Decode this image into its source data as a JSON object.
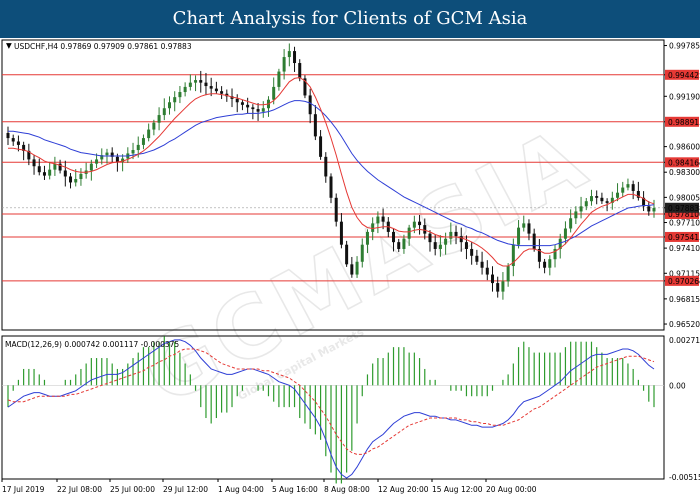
{
  "banner": {
    "title": "Chart Analysis for Clients of GCM Asia"
  },
  "chart_data": {
    "type": "candlestick",
    "price_panel": {
      "header": "USDCHF,H4  0.97869 0.97909 0.97861 0.97883",
      "y_ticks": [
        "0.99785",
        "0.99442",
        "0.99190",
        "0.98891",
        "0.98600",
        "0.98416",
        "0.98300",
        "0.98005",
        "0.97883",
        "0.97810",
        "0.97710",
        "0.97541",
        "0.97410",
        "0.97115",
        "0.97026",
        "0.96815",
        "0.96520"
      ],
      "ylim": [
        0.9645,
        0.9985
      ],
      "levels": [
        {
          "label": "0.99442",
          "value": 0.99442
        },
        {
          "label": "0.98891",
          "value": 0.98891
        },
        {
          "label": "0.98416",
          "value": 0.98416
        },
        {
          "label": "0.97810",
          "value": 0.9781
        },
        {
          "label": "0.97541",
          "value": 0.97541
        },
        {
          "label": "0.97026",
          "value": 0.97026
        }
      ],
      "current_price": {
        "label": "0.97883",
        "value": 0.97883
      },
      "series": [
        {
          "style": "red",
          "role": "fast moving average"
        },
        {
          "style": "blue",
          "role": "slow moving average"
        }
      ],
      "closes": [
        0.987,
        0.9866,
        0.9862,
        0.9855,
        0.9845,
        0.9837,
        0.983,
        0.9826,
        0.9833,
        0.984,
        0.9832,
        0.9825,
        0.9818,
        0.9822,
        0.9828,
        0.9832,
        0.984,
        0.9845,
        0.985,
        0.9853,
        0.9848,
        0.9842,
        0.9846,
        0.9852,
        0.9856,
        0.9862,
        0.987,
        0.988,
        0.9888,
        0.9897,
        0.9905,
        0.9912,
        0.9918,
        0.9924,
        0.993,
        0.9935,
        0.9938,
        0.9935,
        0.9931,
        0.9928,
        0.9925,
        0.9922,
        0.9919,
        0.9916,
        0.9912,
        0.9909,
        0.9906,
        0.9904,
        0.9901,
        0.9905,
        0.9915,
        0.993,
        0.9948,
        0.9965,
        0.9972,
        0.9958,
        0.994,
        0.992,
        0.9898,
        0.9872,
        0.9848,
        0.9825,
        0.98,
        0.9772,
        0.9745,
        0.9722,
        0.971,
        0.9725,
        0.9745,
        0.976,
        0.977,
        0.9778,
        0.9772,
        0.976,
        0.9748,
        0.974,
        0.9752,
        0.9765,
        0.9772,
        0.9768,
        0.9758,
        0.9748,
        0.974,
        0.9745,
        0.9752,
        0.976,
        0.9755,
        0.9748,
        0.974,
        0.9732,
        0.9725,
        0.9718,
        0.971,
        0.97,
        0.969,
        0.9702,
        0.972,
        0.9745,
        0.9765,
        0.977,
        0.9758,
        0.974,
        0.9725,
        0.9718,
        0.9728,
        0.974,
        0.9752,
        0.9764,
        0.9776,
        0.9784,
        0.979,
        0.9796,
        0.9802,
        0.98,
        0.9796,
        0.9794,
        0.98,
        0.9806,
        0.9812,
        0.9816,
        0.9808,
        0.98,
        0.979,
        0.9784,
        0.9788
      ],
      "fast_ma": [
        0.9858,
        0.9858,
        0.9857,
        0.9856,
        0.9854,
        0.985,
        0.9847,
        0.9843,
        0.9841,
        0.984,
        0.9838,
        0.9836,
        0.9833,
        0.9831,
        0.983,
        0.983,
        0.9831,
        0.9833,
        0.9836,
        0.9839,
        0.9841,
        0.9842,
        0.9843,
        0.9845,
        0.9848,
        0.9851,
        0.9855,
        0.986,
        0.9866,
        0.9872,
        0.9879,
        0.9886,
        0.9893,
        0.9899,
        0.9905,
        0.9911,
        0.9916,
        0.9919,
        0.9921,
        0.9922,
        0.9922,
        0.9921,
        0.992,
        0.9918,
        0.9917,
        0.9915,
        0.9913,
        0.9911,
        0.9909,
        0.9909,
        0.991,
        0.9914,
        0.992,
        0.9928,
        0.9936,
        0.994,
        0.9941,
        0.9937,
        0.993,
        0.9918,
        0.9904,
        0.9888,
        0.987,
        0.985,
        0.9828,
        0.9807,
        0.9789,
        0.9777,
        0.9769,
        0.9765,
        0.9764,
        0.9765,
        0.9766,
        0.9766,
        0.9764,
        0.9761,
        0.976,
        0.976,
        0.9762,
        0.9763,
        0.9762,
        0.976,
        0.9757,
        0.9755,
        0.9754,
        0.9754,
        0.9754,
        0.9753,
        0.9751,
        0.9748,
        0.9745,
        0.9741,
        0.9736,
        0.973,
        0.9723,
        0.972,
        0.972,
        0.9724,
        0.973,
        0.9737,
        0.974,
        0.974,
        0.9738,
        0.9735,
        0.9735,
        0.9737,
        0.9741,
        0.9746,
        0.9753,
        0.9761,
        0.9769,
        0.9776,
        0.9783,
        0.9787,
        0.979,
        0.9792,
        0.9795,
        0.9798,
        0.9801,
        0.9804,
        0.9804,
        0.9802,
        0.9799,
        0.9795,
        0.9793
      ],
      "slow_ma": [
        0.9878,
        0.9878,
        0.9877,
        0.9876,
        0.9875,
        0.9873,
        0.9871,
        0.9868,
        0.9866,
        0.9864,
        0.9862,
        0.986,
        0.9857,
        0.9855,
        0.9853,
        0.9852,
        0.9851,
        0.985,
        0.9849,
        0.9849,
        0.9849,
        0.9849,
        0.9849,
        0.9849,
        0.985,
        0.9851,
        0.9852,
        0.9854,
        0.9856,
        0.9859,
        0.9862,
        0.9866,
        0.9869,
        0.9873,
        0.9877,
        0.9881,
        0.9885,
        0.9888,
        0.989,
        0.9892,
        0.9894,
        0.9895,
        0.9896,
        0.9897,
        0.9898,
        0.9898,
        0.9899,
        0.9899,
        0.9899,
        0.99,
        0.9901,
        0.9903,
        0.9906,
        0.9909,
        0.9912,
        0.9914,
        0.9914,
        0.9913,
        0.9911,
        0.9907,
        0.9902,
        0.9896,
        0.9889,
        0.9881,
        0.9872,
        0.9862,
        0.9852,
        0.9844,
        0.9837,
        0.9831,
        0.9826,
        0.9821,
        0.9817,
        0.9813,
        0.9809,
        0.9805,
        0.9801,
        0.9798,
        0.9795,
        0.9792,
        0.9789,
        0.9786,
        0.9783,
        0.978,
        0.9777,
        0.9774,
        0.9771,
        0.9769,
        0.9766,
        0.9764,
        0.9761,
        0.9759,
        0.9756,
        0.9753,
        0.975,
        0.9748,
        0.9746,
        0.9745,
        0.9744,
        0.9744,
        0.9744,
        0.9744,
        0.9744,
        0.9744,
        0.9744,
        0.9745,
        0.9747,
        0.9749,
        0.9752,
        0.9755,
        0.9759,
        0.9763,
        0.9767,
        0.977,
        0.9773,
        0.9776,
        0.9779,
        0.9782,
        0.9785,
        0.9788,
        0.9789,
        0.979,
        0.9791,
        0.9791,
        0.9792
      ]
    },
    "macd_panel": {
      "header": "MACD(12,26,9) 0.000742 0.001117 -0.000375",
      "y_ticks": [
        "0.002713",
        "0.00",
        "-0.005154"
      ],
      "ylim": [
        -0.005154,
        0.002713
      ],
      "macd": [
        -0.0012,
        -0.001,
        -0.0008,
        -0.0006,
        -0.0005,
        -0.0004,
        -0.0004,
        -0.0005,
        -0.0006,
        -0.0006,
        -0.0006,
        -0.0005,
        -0.0004,
        -0.0003,
        -0.0001,
        0.0001,
        0.0003,
        0.0004,
        0.0005,
        0.0006,
        0.0006,
        0.0006,
        0.0007,
        0.0009,
        0.0011,
        0.0013,
        0.0015,
        0.0017,
        0.0019,
        0.0021,
        0.0023,
        0.0024,
        0.0025,
        0.0025,
        0.0024,
        0.0022,
        0.0019,
        0.0015,
        0.0012,
        0.0009,
        0.0008,
        0.0007,
        0.0006,
        0.0006,
        0.0007,
        0.0008,
        0.0009,
        0.0009,
        0.0008,
        0.0007,
        0.0006,
        0.0004,
        0.0002,
        0.0001,
        0.0,
        -0.0002,
        -0.0006,
        -0.001,
        -0.0014,
        -0.0018,
        -0.0023,
        -0.003,
        -0.0038,
        -0.0045,
        -0.0049,
        -0.0051,
        -0.0049,
        -0.0045,
        -0.004,
        -0.0035,
        -0.0031,
        -0.0029,
        -0.0027,
        -0.0024,
        -0.0021,
        -0.0019,
        -0.0017,
        -0.0016,
        -0.0015,
        -0.0015,
        -0.0016,
        -0.0017,
        -0.0017,
        -0.0018,
        -0.0018,
        -0.0019,
        -0.0019,
        -0.002,
        -0.0021,
        -0.0022,
        -0.0022,
        -0.0023,
        -0.0023,
        -0.0023,
        -0.0022,
        -0.0021,
        -0.0019,
        -0.0016,
        -0.0012,
        -0.0009,
        -0.0008,
        -0.0007,
        -0.0006,
        -0.0004,
        -0.0002,
        0.0,
        0.0002,
        0.0005,
        0.0008,
        0.001,
        0.0012,
        0.0014,
        0.0016,
        0.0017,
        0.0017,
        0.0017,
        0.0018,
        0.0019,
        0.002,
        0.002,
        0.0019,
        0.0017,
        0.0014,
        0.0011,
        0.0009
      ],
      "signal": [
        -0.0008,
        -0.0009,
        -0.0009,
        -0.0009,
        -0.0008,
        -0.0007,
        -0.0006,
        -0.0006,
        -0.0006,
        -0.0006,
        -0.0006,
        -0.0006,
        -0.0005,
        -0.0005,
        -0.0004,
        -0.0003,
        -0.0002,
        -0.0001,
        0.0,
        0.0001,
        0.0002,
        0.0003,
        0.0004,
        0.0005,
        0.0006,
        0.0007,
        0.0008,
        0.001,
        0.0011,
        0.0013,
        0.0014,
        0.0016,
        0.0017,
        0.0019,
        0.002,
        0.002,
        0.002,
        0.0019,
        0.0018,
        0.0016,
        0.0014,
        0.0012,
        0.0011,
        0.001,
        0.0009,
        0.0009,
        0.0009,
        0.0009,
        0.0009,
        0.0008,
        0.0008,
        0.0007,
        0.0006,
        0.0005,
        0.0004,
        0.0002,
        0.0,
        -0.0003,
        -0.0006,
        -0.0009,
        -0.0013,
        -0.0017,
        -0.0022,
        -0.0027,
        -0.0031,
        -0.0035,
        -0.0037,
        -0.0038,
        -0.0038,
        -0.0037,
        -0.0035,
        -0.0034,
        -0.0032,
        -0.003,
        -0.0028,
        -0.0026,
        -0.0024,
        -0.0022,
        -0.0021,
        -0.002,
        -0.0019,
        -0.0018,
        -0.0018,
        -0.0018,
        -0.0018,
        -0.0018,
        -0.0018,
        -0.0019,
        -0.0019,
        -0.002,
        -0.002,
        -0.0021,
        -0.0021,
        -0.0022,
        -0.0022,
        -0.0022,
        -0.0021,
        -0.002,
        -0.0019,
        -0.0017,
        -0.0015,
        -0.0013,
        -0.0012,
        -0.001,
        -0.0008,
        -0.0006,
        -0.0004,
        -0.0002,
        0.0,
        0.0002,
        0.0004,
        0.0006,
        0.0008,
        0.001,
        0.0011,
        0.0012,
        0.0013,
        0.0014,
        0.0015,
        0.0016,
        0.0016,
        0.0016,
        0.0015,
        0.0014,
        0.0013
      ]
    },
    "x_ticks": [
      "17 Jul 2019",
      "22 Jul 08:00",
      "25 Jul 00:00",
      "29 Jul 12:00",
      "1 Aug 04:00",
      "5 Aug 16:00",
      "8 Aug 08:00",
      "12 Aug 20:00",
      "15 Aug 12:00",
      "20 Aug 00:00"
    ],
    "colors": {
      "up": "#2e7d32",
      "down": "#111111",
      "fast_ma": "#e53935",
      "slow_ma": "#2f3fd6",
      "level": "#e53935",
      "macd_main": "#2f3fd6",
      "macd_signal": "#e53935",
      "histogram": "#2e9b2e"
    }
  },
  "watermark": {
    "text": "GCMASIA",
    "subtext": "Global Capital Markets"
  }
}
